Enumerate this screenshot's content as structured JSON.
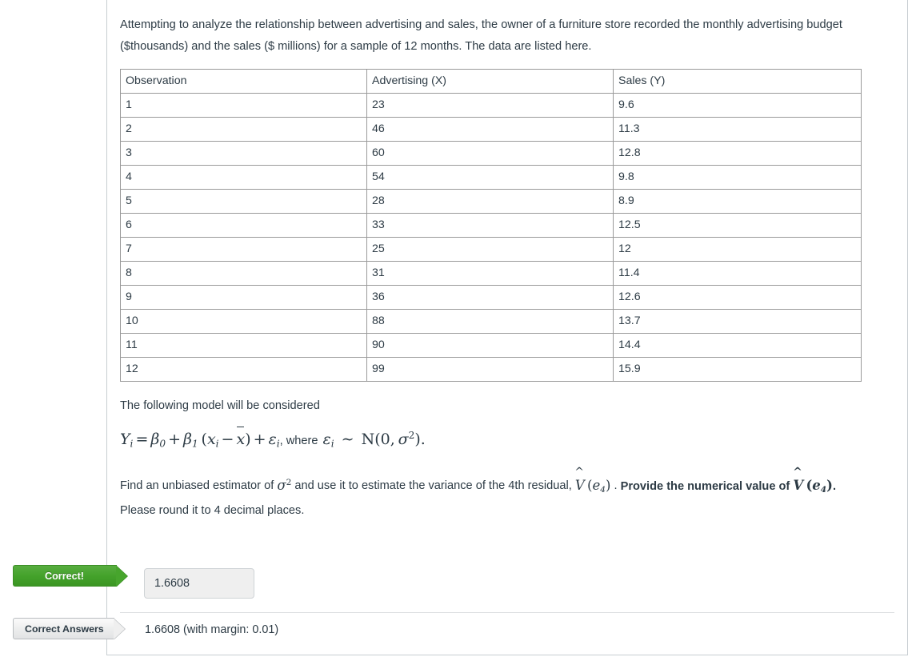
{
  "question": {
    "prompt": "Attempting to analyze the relationship between advertising and sales, the owner of a furniture store recorded the monthly advertising budget ($thousands) and the sales ($ millions) for a sample of 12 months. The data are listed here.",
    "model_lead": "The following model will be considered",
    "formula_plain": "Y_i = β_0 + β_1 (x_i − x̄) + ϵ_i, where ϵ_i ~ N(0, σ²).",
    "where_label": ", where",
    "ask_part1": "Find an unbiased estimator of",
    "ask_sigma2": "σ²",
    "ask_part2": "and use it to estimate the variance of the 4th residual,",
    "ask_vhat1": "V̂(e₄)",
    "ask_period": ".",
    "ask_bold_part": "Provide the numerical value of",
    "ask_vhat2": "V̂(e₄)",
    "ask_bold_period": ".",
    "ask_part3": "Please round it to 4 decimal places."
  },
  "table": {
    "headers": [
      "Observation",
      "Advertising (X)",
      "Sales (Y)"
    ],
    "rows": [
      [
        "1",
        "23",
        "9.6"
      ],
      [
        "2",
        "46",
        "11.3"
      ],
      [
        "3",
        "60",
        "12.8"
      ],
      [
        "4",
        "54",
        "9.8"
      ],
      [
        "5",
        "28",
        "8.9"
      ],
      [
        "6",
        "33",
        "12.5"
      ],
      [
        "7",
        "25",
        "12"
      ],
      [
        "8",
        "31",
        "11.4"
      ],
      [
        "9",
        "36",
        "12.6"
      ],
      [
        "10",
        "88",
        "13.7"
      ],
      [
        "11",
        "90",
        "14.4"
      ],
      [
        "12",
        "99",
        "15.9"
      ]
    ]
  },
  "result": {
    "status_flag_label": "Correct!",
    "submitted_answer": "1.6608",
    "answers_flag_label": "Correct Answers",
    "correct_answer_text": "1.6608 (with margin: 0.01)"
  },
  "colors": {
    "correct_green": "#43a12a",
    "text": "#2d3b45",
    "border_gray": "#c7cdd1",
    "table_border": "#9a9a9a",
    "input_bg": "#efefef"
  }
}
